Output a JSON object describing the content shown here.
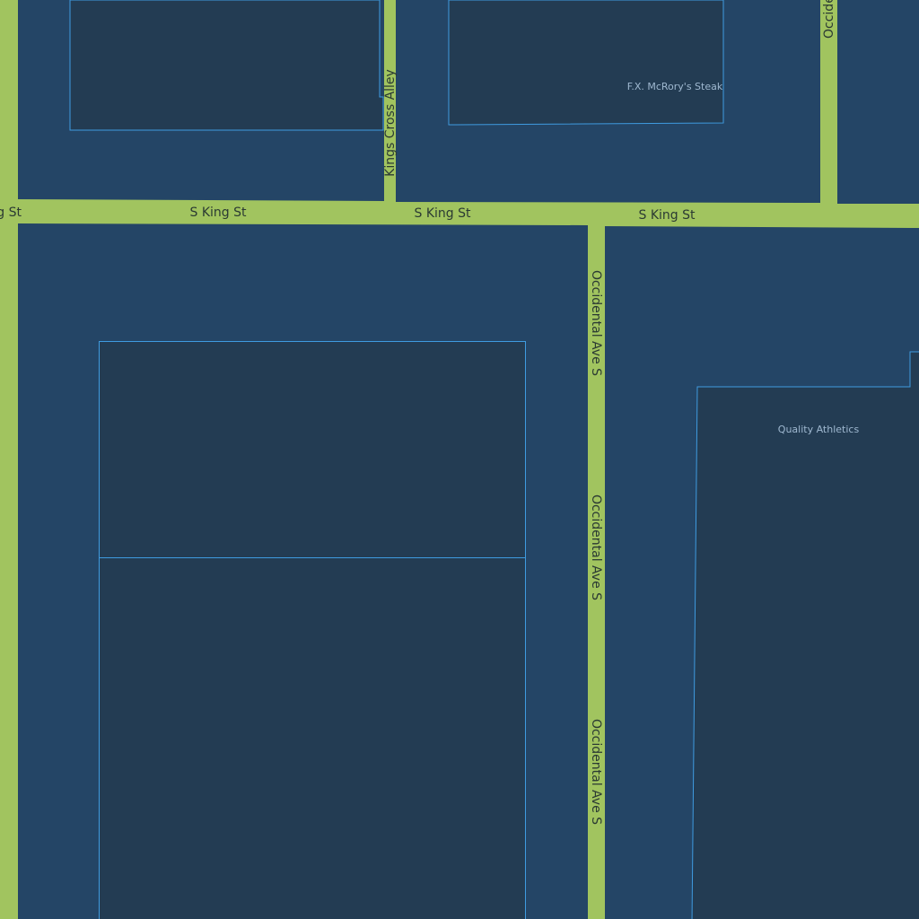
{
  "colors": {
    "road": "#a1c45f",
    "block": "#244566",
    "building": "#233c53",
    "building_outline": "#3f9be0",
    "street_text": "#2b3a33",
    "poi_text": "#9fb8d0"
  },
  "streets": {
    "king_partial": "g St",
    "king_1": "S King St",
    "king_2": "S King St",
    "king_3": "S King St",
    "kings_cross_alley": "Kings Cross Alley",
    "occidental_top": "Occide",
    "occidental_1": "Occidental Ave S",
    "occidental_2": "Occidental Ave S",
    "occidental_3": "Occidental Ave S"
  },
  "pois": {
    "fx_mcrory": "F.X. McRory's Steak",
    "quality_athletics": "Quality Athletics"
  }
}
